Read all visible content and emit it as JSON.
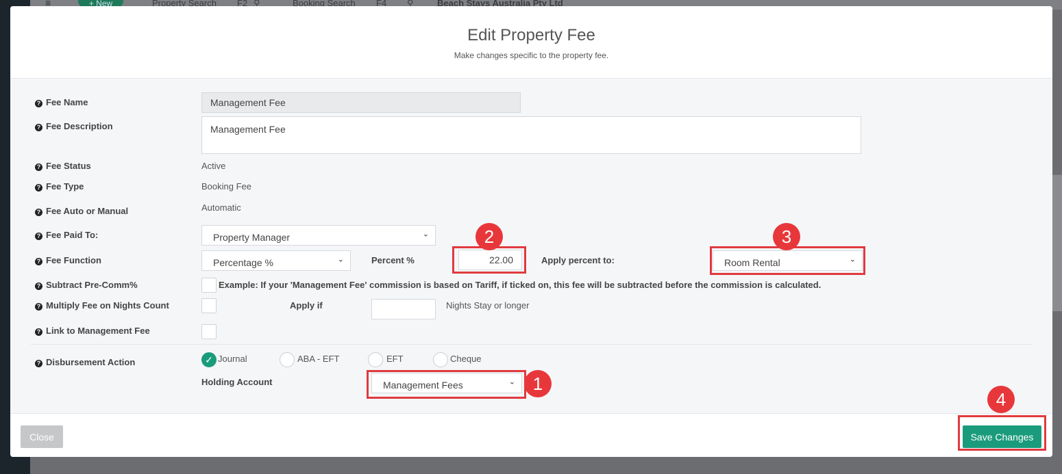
{
  "background": {
    "new_button": "+ New",
    "property_search": "Property Search",
    "property_search_key": "F2",
    "booking_search": "Booking Search",
    "booking_search_key": "F4",
    "company": "Beach Stays Australia Pty Ltd"
  },
  "modal": {
    "title": "Edit Property Fee",
    "subtitle": "Make changes specific to the property fee."
  },
  "form": {
    "fee_name_label": "Fee Name",
    "fee_name_value": "Management Fee",
    "fee_description_label": "Fee Description",
    "fee_description_value": "Management Fee",
    "fee_status_label": "Fee Status",
    "fee_status_value": "Active",
    "fee_type_label": "Fee Type",
    "fee_type_value": "Booking Fee",
    "fee_auto_label": "Fee Auto or Manual",
    "fee_auto_value": "Automatic",
    "fee_paid_to_label": "Fee Paid To:",
    "fee_paid_to_value": "Property Manager",
    "fee_function_label": "Fee Function",
    "fee_function_value": "Percentage %",
    "percent_label": "Percent %",
    "percent_value": "22.00",
    "apply_percent_label": "Apply percent to:",
    "apply_percent_value": "Room Rental",
    "subtract_label": "Subtract Pre-Comm%",
    "subtract_example": "Example: If your 'Management Fee' commission is based on Tariff, if ticked on, this fee will be subtracted before the commission is calculated.",
    "multiply_label": "Multiply Fee on Nights Count",
    "apply_if_label": "Apply if",
    "apply_if_value": "",
    "nights_suffix": "Nights Stay or longer",
    "link_label": "Link to Management Fee",
    "disbursement_label": "Disbursement Action",
    "disbursement_options": [
      "Journal",
      "ABA - EFT",
      "EFT",
      "Cheque"
    ],
    "disbursement_selected": "Journal",
    "holding_account_label": "Holding Account",
    "holding_account_value": "Management Fees"
  },
  "footer": {
    "close_label": "Close",
    "save_label": "Save Changes"
  },
  "annotations": [
    "1",
    "2",
    "3",
    "4"
  ],
  "colors": {
    "accent": "#1a9c7c",
    "highlight": "#e03a3e"
  }
}
